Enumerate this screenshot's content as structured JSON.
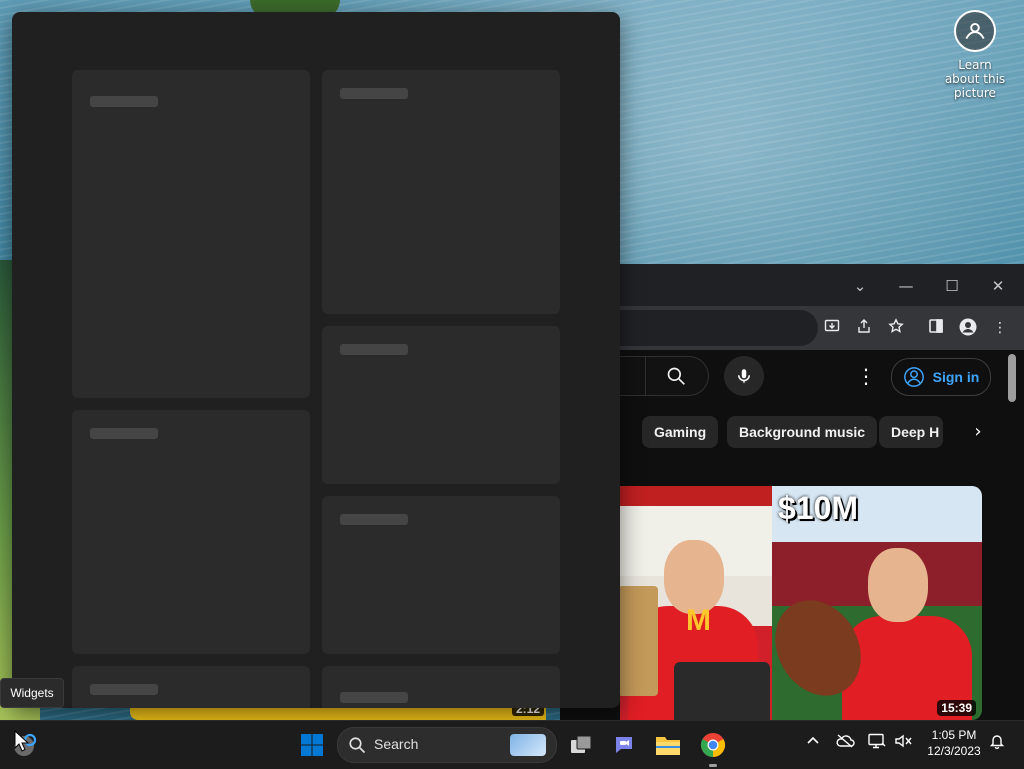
{
  "desktop": {
    "learn_label": "Learn about this picture"
  },
  "browser": {
    "window_controls": {
      "dropdown": "⌄",
      "minimize": "—",
      "maximize": "☐",
      "close": "✕"
    },
    "youtube": {
      "sign_in_label": "Sign in",
      "more_icon": "⋮",
      "chips": [
        "Gaming",
        "Background music",
        "Deep H"
      ],
      "chips_next": "›",
      "thumbnails": [
        {
          "logo_text": "M"
        },
        {
          "overlay_text": "$10M",
          "duration": "15:39"
        }
      ],
      "bottom_duration": "2:12"
    }
  },
  "widgets_panel": {
    "tooltip": "Widgets"
  },
  "taskbar": {
    "search_label": "Search",
    "clock_time": "1:05 PM",
    "clock_date": "12/3/2023",
    "tray_icons": [
      "chevron-up-icon",
      "onedrive-icon",
      "monitor-icon",
      "speaker-muted-icon",
      "bell-icon"
    ],
    "colors": {
      "windows_blue": "#0078d4",
      "chrome_red": "#ea4335",
      "chrome_yellow": "#fbbc04",
      "chrome_green": "#34a853"
    }
  }
}
